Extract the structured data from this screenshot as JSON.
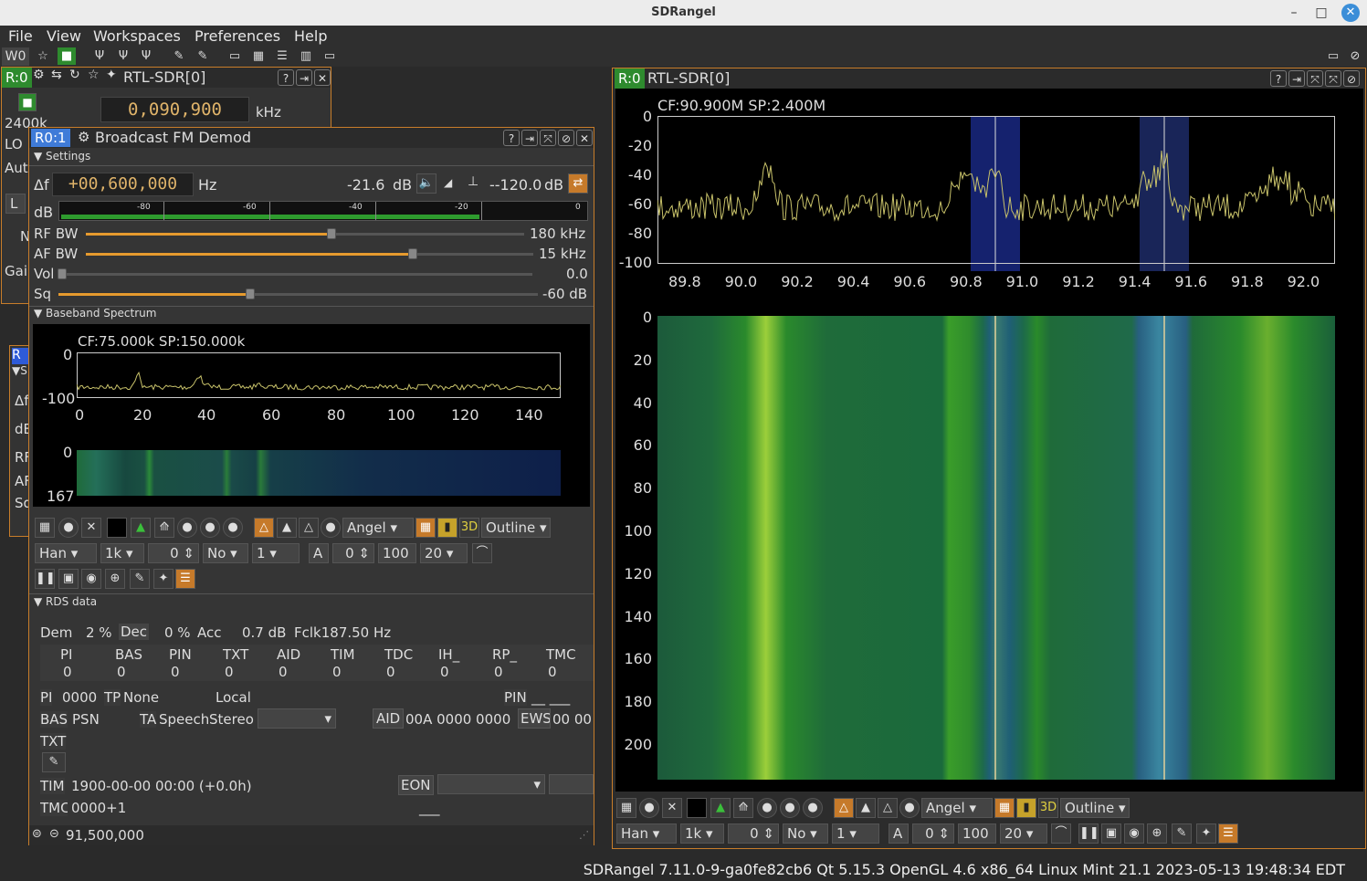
{
  "window": {
    "title": "SDRangel",
    "minimize": "–",
    "maximize": "□",
    "close": "✕"
  },
  "menu": [
    "File",
    "View",
    "Workspaces",
    "Preferences",
    "Help"
  ],
  "toolbar": {
    "workspace": "W0"
  },
  "dev_panel": {
    "tag": "R:0",
    "name": "RTL-SDR[0]",
    "freq": "0,090,900",
    "unit": "kHz",
    "sr": "2400k",
    "lo": "LO",
    "auto": "Aut",
    "l": "L",
    "n": "N",
    "gain": "Gai"
  },
  "fm": {
    "tag": "R0:1",
    "title": "Broadcast FM Demod",
    "settings": "Settings",
    "df": "Δf",
    "df_value": "+00,600,000",
    "hz": "Hz",
    "level": "-21.6",
    "db": "dB",
    "squelch_level": "--120.0",
    "squelch_db": "dB",
    "meter_db": "dB",
    "meter_ticks": [
      "-80",
      "-60",
      "-40",
      "-20",
      "0"
    ],
    "rfbw": "RF BW",
    "rfbw_val": "180 kHz",
    "rfbw_frac": 0.56,
    "afbw": "AF BW",
    "afbw_val": "15 kHz",
    "afbw_frac": 0.73,
    "vol": "Vol",
    "vol_val": "0.0",
    "vol_frac": 0.0,
    "sq": "Sq",
    "sq_val": "-60 dB",
    "sq_frac": 0.4,
    "bb": "Baseband Spectrum",
    "bb_info": "CF:75.000k SP:150.000k",
    "bb_y": [
      "0",
      "-100"
    ],
    "bb_x": [
      "0",
      "20",
      "40",
      "60",
      "80",
      "100",
      "120",
      "140"
    ],
    "wf_y": [
      "0",
      "167"
    ],
    "ctl1": {
      "angel": "Angel",
      "outline": "Outline"
    },
    "ctl2": {
      "win": "Han",
      "fft": "1k",
      "avg0": "0",
      "no": "No",
      "one": "1",
      "a": "A",
      "a0": "0",
      "hundred": "100",
      "twenty": "20"
    },
    "rds": "RDS data",
    "dem": "Dem",
    "dem_v": "2 %",
    "dec": "Dec",
    "dec_v": "0 %",
    "acc": "Acc",
    "acc_v": "0.7 dB",
    "fclk": "Fclk187.50 Hz",
    "cols": [
      "PI",
      "BAS",
      "PIN",
      "TXT",
      "AID",
      "TIM",
      "TDC",
      "IH_",
      "RP_",
      "TMC"
    ],
    "colvals": [
      "0",
      "0",
      "0",
      "0",
      "0",
      "0",
      "0",
      "0",
      "0",
      "0"
    ],
    "pi": "PI",
    "pi_v": "0000",
    "tp": "TP",
    "none": "None",
    "local": "Local",
    "pin": "PIN",
    "pin_v": "__ ___",
    "bas": "BAS",
    "psn": "PSN",
    "ta": "TA",
    "speech": "Speech",
    "stereo": "Stereo",
    "aid": "AID",
    "aid_v": "00A 0000 0000",
    "ews": "EWS",
    "ews_v": "00 00",
    "txt": "TXT",
    "tim": "TIM",
    "tim_v": "1900-00-00 00:00 (+0.0h)",
    "eon": "EON",
    "tmc": "TMC",
    "tmc_v": "0000+1",
    "tmc_u": "___",
    "freq_foot": "91,500,000"
  },
  "main": {
    "tag": "R:0",
    "name": "RTL-SDR[0]",
    "info": "CF:90.900M SP:2.400M",
    "spec_y": [
      "0",
      "-20",
      "-40",
      "-60",
      "-80",
      "-100"
    ],
    "spec_x": [
      "89.8",
      "90.0",
      "90.2",
      "90.4",
      "90.6",
      "90.8",
      "91.0",
      "91.2",
      "91.4",
      "91.6",
      "91.8",
      "92.0"
    ],
    "wf_y": [
      "0",
      "20",
      "40",
      "60",
      "80",
      "100",
      "120",
      "140",
      "160",
      "180",
      "200"
    ],
    "angel": "Angel",
    "outline": "Outline",
    "win": "Han",
    "fft": "1k",
    "avg0": "0",
    "no": "No",
    "one": "1",
    "a": "A",
    "a0": "0",
    "hundred": "100",
    "twenty": "20"
  },
  "hidden_panel": {
    "tag": "R",
    "s": "▼S",
    "rows": [
      "Δf",
      "dB",
      "RF",
      "AF",
      "Sq"
    ]
  },
  "status": "SDRangel 7.11.0-9-ga0fe82cb6 Qt 5.15.3 OpenGL 4.6 x86_64 Linux Mint 21.1 2023-05-13 19:48:34 EDT"
}
